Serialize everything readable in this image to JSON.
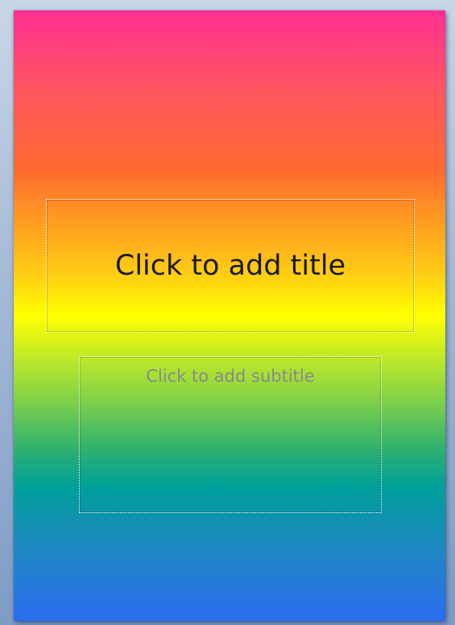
{
  "slide": {
    "title_placeholder": "Click to add title",
    "subtitle_placeholder": "Click to add subtitle",
    "background_gradient_colors": [
      "#ff2f92",
      "#ff6a30",
      "#ffff00",
      "#7fd04a",
      "#00a09a",
      "#2c6cf0"
    ],
    "title_text_color": "#1a1a1a",
    "subtitle_text_color": "#8a8a8a"
  }
}
